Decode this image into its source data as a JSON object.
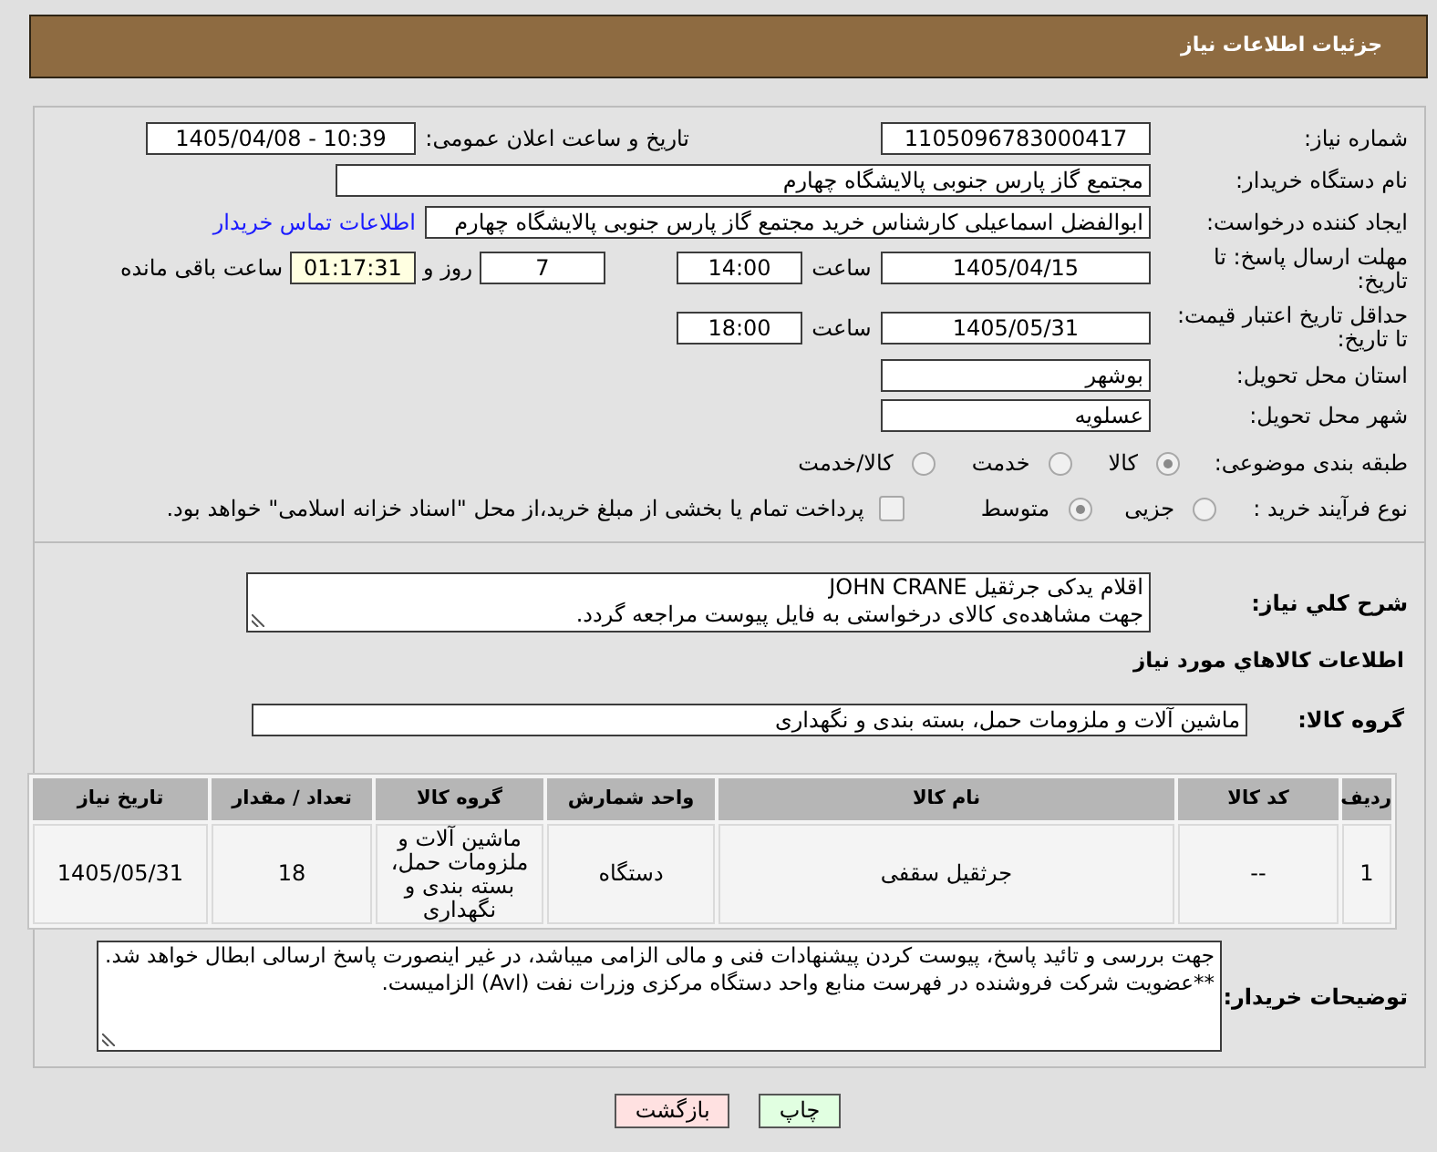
{
  "header": {
    "title": "جزئیات اطلاعات نیاز"
  },
  "need_number": {
    "label": "شماره نیاز:",
    "value": "1105096783000417"
  },
  "announce_datetime": {
    "label": "تاریخ و ساعت اعلان عمومی:",
    "value": "1405/04/08 - 10:39"
  },
  "buyer_org": {
    "label": "نام دستگاه خریدار:",
    "value": "مجتمع گاز پارس جنوبی  پالایشگاه چهارم"
  },
  "requester": {
    "label": "ایجاد کننده درخواست:",
    "value": "ابوالفضل اسماعیلی کارشناس خرید مجتمع گاز پارس جنوبی  پالایشگاه چهارم",
    "link": "اطلاعات تماس خریدار"
  },
  "response_deadline": {
    "label": "مهلت ارسال پاسخ: تا تاریخ:",
    "date": "1405/04/15",
    "time_label": "ساعت",
    "time": "14:00",
    "days": "7",
    "days_label": "روز و",
    "remaining": "01:17:31",
    "remaining_label": "ساعت باقی مانده"
  },
  "price_validity": {
    "label": "حداقل تاریخ اعتبار قیمت: تا تاریخ:",
    "date": "1405/05/31",
    "time_label": "ساعت",
    "time": "18:00"
  },
  "delivery_province": {
    "label": "استان محل تحویل:",
    "value": "بوشهر"
  },
  "delivery_city": {
    "label": "شهر محل تحویل:",
    "value": "عسلویه"
  },
  "category": {
    "label": "طبقه بندی موضوعی:",
    "options": [
      {
        "label": "کالا",
        "selected": true
      },
      {
        "label": "خدمت",
        "selected": false
      },
      {
        "label": "کالا/خدمت",
        "selected": false
      }
    ]
  },
  "purchase_process": {
    "label": "نوع فرآیند خرید :",
    "options": [
      {
        "label": "جزیی",
        "selected": false
      },
      {
        "label": "متوسط",
        "selected": true
      }
    ],
    "treasury_payment": {
      "label": "پرداخت تمام یا بخشی از مبلغ خرید،از محل \"اسناد خزانه اسلامی\" خواهد بود.",
      "checked": false
    }
  },
  "general_description": {
    "label": "شرح کلي نياز:",
    "lines": [
      "اقلام یدکی جرثقیل JOHN CRANE",
      "جهت مشاهده‌ی کالای درخواستی به فایل پیوست مراجعه گردد."
    ]
  },
  "goods_section_title": "اطلاعات کالاهاي مورد نياز",
  "goods_group": {
    "label": "گروه کالا:",
    "value": "ماشین آلات و ملزومات حمل، بسته بندی و نگهداری"
  },
  "table": {
    "columns": [
      "ردیف",
      "کد کالا",
      "نام کالا",
      "واحد شمارش",
      "گروه کالا",
      "تعداد / مقدار",
      "تاریخ نیاز"
    ],
    "rows": [
      [
        "1",
        "--",
        "جرثقیل سقفی",
        "دستگاه",
        "ماشین آلات و ملزومات حمل، بسته بندی و نگهداری",
        "18",
        "1405/05/31"
      ]
    ]
  },
  "buyer_notes": {
    "label": "توضیحات خریدار:",
    "lines": [
      "جهت بررسی و تائید پاسخ، پیوست کردن پیشنهادات فنی و مالی الزامی میباشد، در غیر اینصورت پاسخ ارسالی ابطال خواهد شد.",
      "**عضویت شرکت فروشنده در فهرست منابع واحد دستگاه مرکزی وزرات نفت (Avl) الزامیست."
    ]
  },
  "buttons": [
    {
      "label": "چاپ",
      "kind": "print"
    },
    {
      "label": "بازگشت",
      "kind": "back"
    }
  ]
}
